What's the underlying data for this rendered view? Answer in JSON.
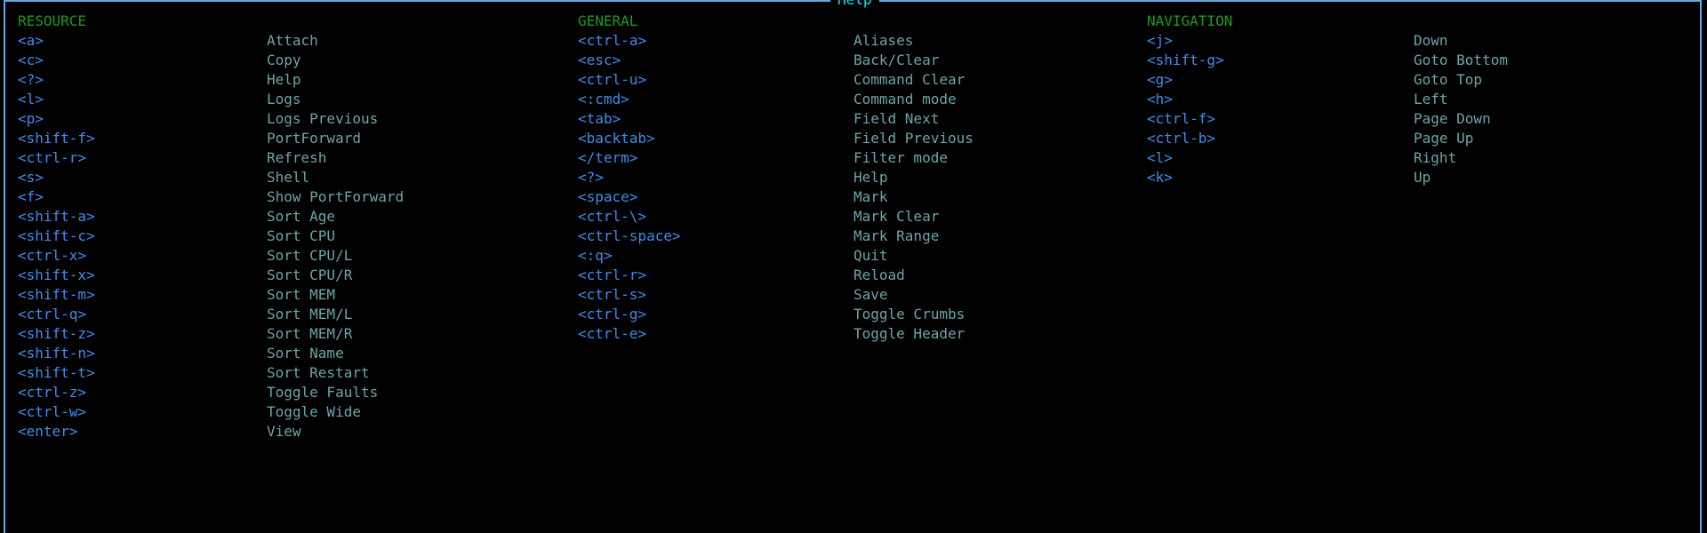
{
  "title": "Help",
  "colors": {
    "border": "#5fa8e0",
    "title": "#00e5ff",
    "header": "#1a9c1a",
    "key": "#3b8eea",
    "desc": "#6aa5a8"
  },
  "sections": [
    {
      "header": "RESOURCE",
      "rows": [
        {
          "key": "<a>",
          "desc": "Attach"
        },
        {
          "key": "<c>",
          "desc": "Copy"
        },
        {
          "key": "<?>",
          "desc": "Help"
        },
        {
          "key": "<l>",
          "desc": "Logs"
        },
        {
          "key": "<p>",
          "desc": "Logs Previous"
        },
        {
          "key": "<shift-f>",
          "desc": "PortForward"
        },
        {
          "key": "<ctrl-r>",
          "desc": "Refresh"
        },
        {
          "key": "<s>",
          "desc": "Shell"
        },
        {
          "key": "<f>",
          "desc": "Show PortForward"
        },
        {
          "key": "<shift-a>",
          "desc": "Sort Age"
        },
        {
          "key": "<shift-c>",
          "desc": "Sort CPU"
        },
        {
          "key": "<ctrl-x>",
          "desc": "Sort CPU/L"
        },
        {
          "key": "<shift-x>",
          "desc": "Sort CPU/R"
        },
        {
          "key": "<shift-m>",
          "desc": "Sort MEM"
        },
        {
          "key": "<ctrl-q>",
          "desc": "Sort MEM/L"
        },
        {
          "key": "<shift-z>",
          "desc": "Sort MEM/R"
        },
        {
          "key": "<shift-n>",
          "desc": "Sort Name"
        },
        {
          "key": "<shift-t>",
          "desc": "Sort Restart"
        },
        {
          "key": "<ctrl-z>",
          "desc": "Toggle Faults"
        },
        {
          "key": "<ctrl-w>",
          "desc": "Toggle Wide"
        },
        {
          "key": "<enter>",
          "desc": "View"
        }
      ]
    },
    {
      "header": "GENERAL",
      "rows": [
        {
          "key": "<ctrl-a>",
          "desc": "Aliases"
        },
        {
          "key": "<esc>",
          "desc": "Back/Clear"
        },
        {
          "key": "<ctrl-u>",
          "desc": "Command Clear"
        },
        {
          "key": "<:cmd>",
          "desc": "Command mode"
        },
        {
          "key": "<tab>",
          "desc": "Field Next"
        },
        {
          "key": "<backtab>",
          "desc": "Field Previous"
        },
        {
          "key": "</term>",
          "desc": "Filter mode"
        },
        {
          "key": "<?>",
          "desc": "Help"
        },
        {
          "key": "<space>",
          "desc": "Mark"
        },
        {
          "key": "<ctrl-\\>",
          "desc": "Mark Clear"
        },
        {
          "key": "<ctrl-space>",
          "desc": "Mark Range"
        },
        {
          "key": "<:q>",
          "desc": "Quit"
        },
        {
          "key": "<ctrl-r>",
          "desc": "Reload"
        },
        {
          "key": "<ctrl-s>",
          "desc": "Save"
        },
        {
          "key": "<ctrl-g>",
          "desc": "Toggle Crumbs"
        },
        {
          "key": "<ctrl-e>",
          "desc": "Toggle Header"
        }
      ]
    },
    {
      "header": "NAVIGATION",
      "rows": [
        {
          "key": "<j>",
          "desc": "Down"
        },
        {
          "key": "<shift-g>",
          "desc": "Goto Bottom"
        },
        {
          "key": "<g>",
          "desc": "Goto Top"
        },
        {
          "key": "<h>",
          "desc": "Left"
        },
        {
          "key": "<ctrl-f>",
          "desc": "Page Down"
        },
        {
          "key": "<ctrl-b>",
          "desc": "Page Up"
        },
        {
          "key": "<l>",
          "desc": "Right"
        },
        {
          "key": "<k>",
          "desc": "Up"
        }
      ]
    }
  ]
}
